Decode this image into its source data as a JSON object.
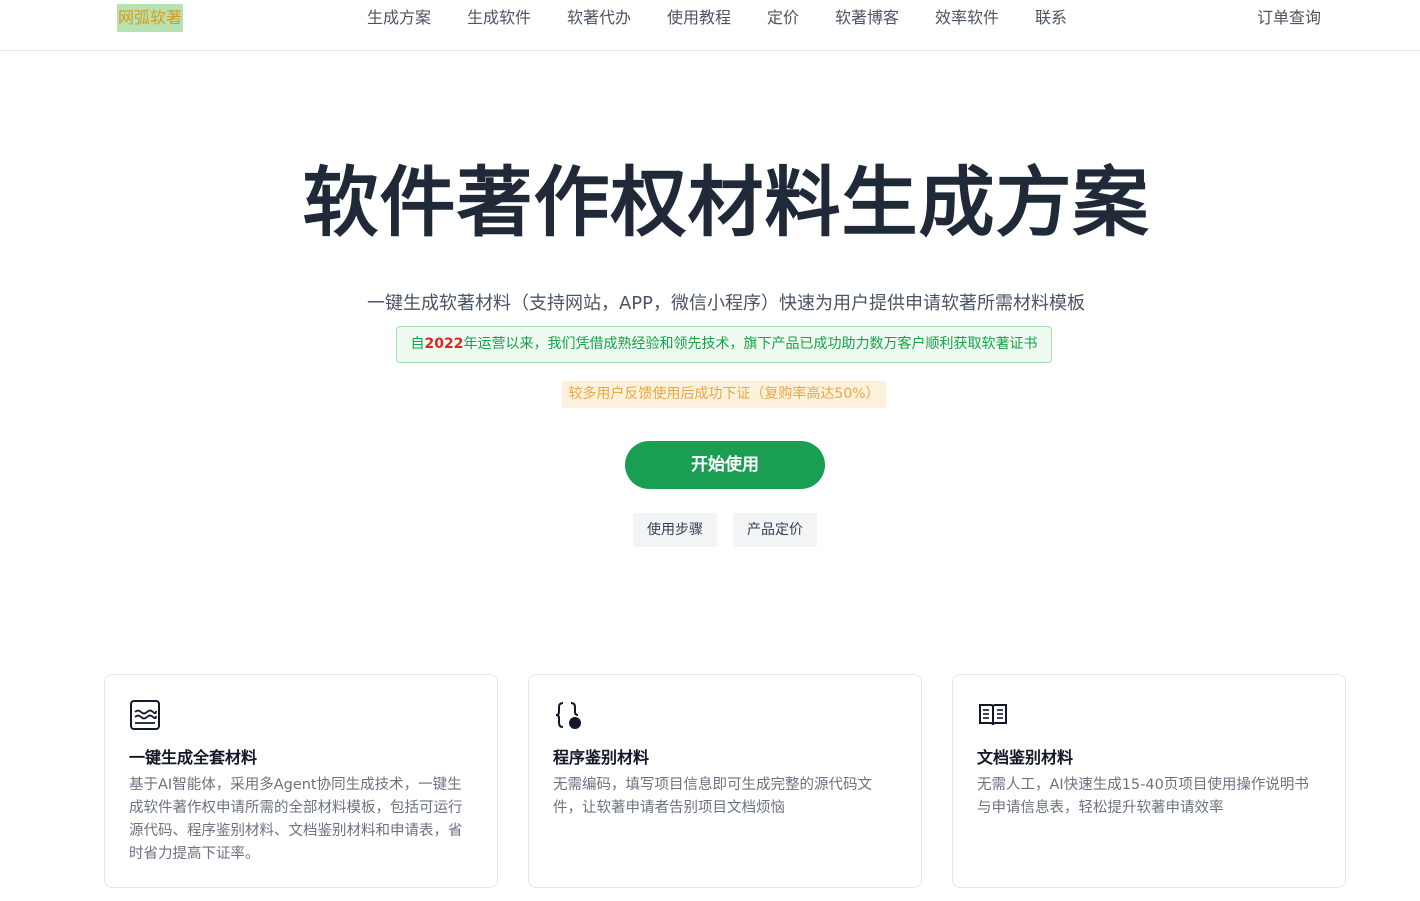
{
  "header": {
    "logo": "网弧软著",
    "nav": [
      "生成方案",
      "生成软件",
      "软著代办",
      "使用教程",
      "定价",
      "软著博客",
      "效率软件",
      "联系"
    ],
    "order_query": "订单查询"
  },
  "hero": {
    "title": "软件著作权材料生成方案",
    "subtitle": "一键生成软著材料（支持网站，APP，微信小程序）快速为用户提供申请软著所需材料模板",
    "banner_prefix": "自",
    "banner_year": "2022",
    "banner_suffix": "年运营以来，我们凭借成熟经验和领先技术，旗下产品已成功助力数万客户顺利获取软著证书",
    "notice": "较多用户反馈使用后成功下证（复购率高达50%）",
    "start_label": "开始使用",
    "steps_label": "使用步骤",
    "pricing_label": "产品定价"
  },
  "cards": [
    {
      "icon": "document-wave-icon",
      "title": "一键生成全套材料",
      "desc": "基于AI智能体，采用多Agent协同生成技术，一键生成软件著作权申请所需的全部材料模板，包括可运行源代码、程序鉴别材料、文档鉴别材料和申请表，省时省力提高下证率。"
    },
    {
      "icon": "code-braces-icon",
      "title": "程序鉴别材料",
      "desc": "无需编码，填写项目信息即可生成完整的源代码文件，让软著申请者告别项目文档烦恼"
    },
    {
      "icon": "open-book-icon",
      "title": "文档鉴别材料",
      "desc": "无需人工，AI快速生成15-40页项目使用操作说明书与申请信息表，轻松提升软著申请效率"
    }
  ],
  "colors": {
    "primary": "#1a9e53",
    "year_highlight": "#dc2626",
    "logo_bg": "#b7e2b1",
    "logo_text": "#d99a1e"
  }
}
